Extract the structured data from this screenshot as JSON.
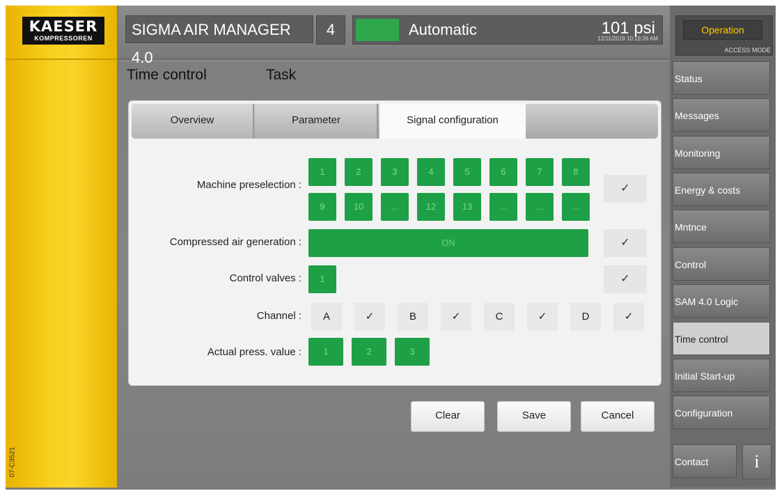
{
  "logo": {
    "line1": "KAESER",
    "line2": "KOMPRESSOREN"
  },
  "doc_code": "07-C3521",
  "topbar": {
    "title": "SIGMA AIR MANAGER 4.0",
    "number": "4",
    "mode": "Automatic",
    "pressure": "101 psi",
    "datetime": "12/11/2019 10:19:26 AM",
    "indicator_color": "#2ea84a"
  },
  "heading": {
    "left": "Time control",
    "right": "Task"
  },
  "tabs": {
    "overview": "Overview",
    "parameter": "Parameter",
    "signal": "Signal configuration"
  },
  "rows": {
    "machine_preselection": {
      "label": "Machine preselection :",
      "buttons_row1": [
        "1",
        "2",
        "3",
        "4",
        "5",
        "6",
        "7",
        "8"
      ],
      "buttons_row2": [
        "9",
        "10",
        "...",
        "12",
        "13",
        "...",
        "...",
        "..."
      ],
      "check": "✓"
    },
    "compressed_air": {
      "label": "Compressed air generation :",
      "value": "ON",
      "check": "✓"
    },
    "control_valves": {
      "label": "Control valves :",
      "buttons": [
        "1"
      ],
      "check": "✓"
    },
    "channel": {
      "label": "Channel :",
      "items": [
        "A",
        "✓",
        "B",
        "✓",
        "C",
        "✓",
        "D",
        "✓"
      ]
    },
    "actual_press": {
      "label": "Actual press. value :",
      "buttons": [
        "1",
        "2",
        "3"
      ]
    }
  },
  "buttons": {
    "clear": "Clear",
    "save": "Save",
    "cancel": "Cancel"
  },
  "right": {
    "operation": "Operation",
    "access_mode": "ACCESS MODE",
    "menu": [
      "Status",
      "Messages",
      "Monitoring",
      "Energy & costs",
      "Mntnce",
      "Control",
      "SAM 4.0 Logic",
      "Time control",
      "Initial Start-up",
      "Configuration"
    ],
    "active_index": 7,
    "contact": "Contact",
    "info": "i"
  },
  "colors": {
    "accent_green": "#1ea046",
    "yellow": "#f7cf1d",
    "operation_text": "#ffcc00"
  }
}
